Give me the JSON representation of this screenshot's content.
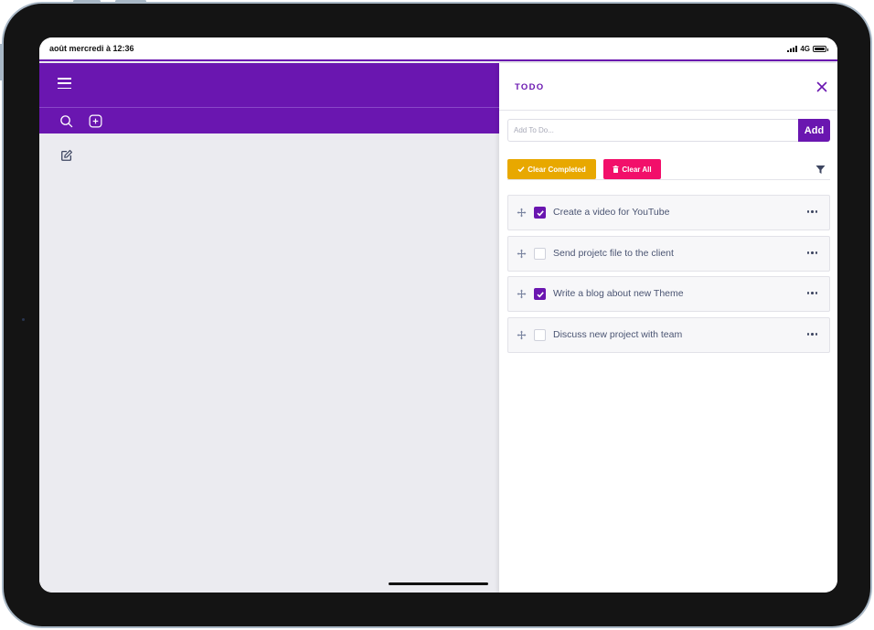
{
  "status_bar": {
    "time": "août mercredi à 12:36",
    "network": "4G"
  },
  "colors": {
    "primary": "#6a16b0",
    "warning": "#e8a800",
    "danger": "#f20f6a",
    "text_muted": "#4a5472"
  },
  "left_pane": {
    "menu_icon": "hamburger-icon",
    "toolbar_icons": [
      "search-icon",
      "add-square-icon"
    ],
    "compose_icon": "edit-icon"
  },
  "todo_panel": {
    "title": "TODO",
    "close_icon": "close-icon",
    "input_placeholder": "Add To Do...",
    "add_label": "Add",
    "clear_completed_label": "Clear Completed",
    "clear_all_label": "Clear All",
    "filter_icon": "filter-icon",
    "items": [
      {
        "text": "Create a video for YouTube",
        "checked": true
      },
      {
        "text": "Send projetc file to the client",
        "checked": false
      },
      {
        "text": "Write a blog about new Theme",
        "checked": true
      },
      {
        "text": "Discuss new project with team",
        "checked": false
      }
    ]
  }
}
